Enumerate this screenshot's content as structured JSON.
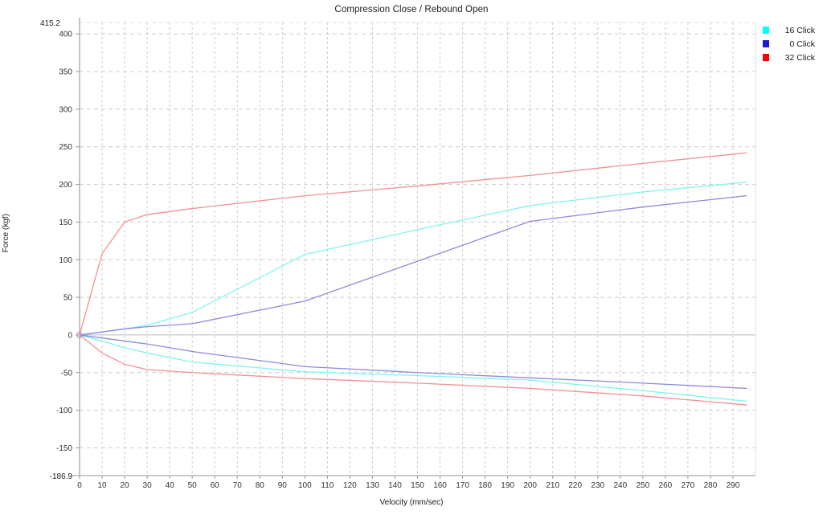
{
  "chart": {
    "title": "Compression Close / Rebound Open",
    "xlabel": "Velocity (mm/sec)",
    "ylabel": "Force (kgf)"
  },
  "legend": {
    "position": "top-right",
    "items": [
      {
        "label": "16 Click",
        "color": "#00ffff",
        "line_color": "#7ff5ef"
      },
      {
        "label": "0 Click",
        "color": "#1a1ad4",
        "line_color": "#8b8bdd"
      },
      {
        "label": "32 Click",
        "color": "#ff0000",
        "line_color": "#f59090"
      }
    ]
  },
  "axes": {
    "y_bound_top": "415.2",
    "y_bound_bottom": "-186.9",
    "y_ticks": [
      "400",
      "350",
      "300",
      "250",
      "200",
      "150",
      "100",
      "50",
      "0",
      "-50",
      "-100",
      "-150"
    ],
    "x_ticks": [
      "0",
      "10",
      "20",
      "30",
      "40",
      "50",
      "60",
      "70",
      "80",
      "90",
      "100",
      "110",
      "120",
      "130",
      "140",
      "150",
      "160",
      "170",
      "180",
      "190",
      "200",
      "210",
      "220",
      "230",
      "240",
      "250",
      "260",
      "270",
      "280",
      "290"
    ]
  },
  "chart_data": {
    "type": "line",
    "title": "Compression Close / Rebound Open",
    "xlabel": "Velocity (mm/sec)",
    "ylabel": "Force (kgf)",
    "xlim": [
      0,
      300
    ],
    "ylim": [
      -186.9,
      415.2
    ],
    "ytick_values": [
      400,
      350,
      300,
      250,
      200,
      150,
      100,
      50,
      0,
      -50,
      -100,
      -150
    ],
    "xtick_values": [
      0,
      10,
      20,
      30,
      40,
      50,
      60,
      70,
      80,
      90,
      100,
      110,
      120,
      130,
      140,
      150,
      160,
      170,
      180,
      190,
      200,
      210,
      220,
      230,
      240,
      250,
      260,
      270,
      280,
      290
    ],
    "grid": true,
    "legend_position": "top-right",
    "series": [
      {
        "name": "16 Click",
        "color": "#7ff5ef",
        "branch": "compression",
        "points": [
          [
            0,
            0
          ],
          [
            10,
            4
          ],
          [
            20,
            8
          ],
          [
            30,
            13
          ],
          [
            50,
            30
          ],
          [
            100,
            107
          ],
          [
            150,
            140
          ],
          [
            200,
            172
          ],
          [
            250,
            190
          ],
          [
            296,
            203
          ]
        ]
      },
      {
        "name": "16 Click",
        "color": "#7ff5ef",
        "branch": "rebound",
        "points": [
          [
            0,
            0
          ],
          [
            10,
            -8
          ],
          [
            20,
            -17
          ],
          [
            30,
            -24
          ],
          [
            50,
            -36
          ],
          [
            100,
            -49
          ],
          [
            150,
            -54
          ],
          [
            200,
            -60
          ],
          [
            250,
            -74
          ],
          [
            296,
            -88
          ]
        ]
      },
      {
        "name": "0 Click",
        "color": "#8b8bdd",
        "branch": "compression",
        "points": [
          [
            0,
            0
          ],
          [
            10,
            4
          ],
          [
            20,
            8
          ],
          [
            30,
            11
          ],
          [
            50,
            15
          ],
          [
            100,
            45
          ],
          [
            150,
            98
          ],
          [
            200,
            151
          ],
          [
            250,
            170
          ],
          [
            296,
            185
          ]
        ]
      },
      {
        "name": "0 Click",
        "color": "#8b8bdd",
        "branch": "rebound",
        "points": [
          [
            0,
            0
          ],
          [
            10,
            -4
          ],
          [
            20,
            -8
          ],
          [
            30,
            -12
          ],
          [
            50,
            -22
          ],
          [
            100,
            -42
          ],
          [
            150,
            -50
          ],
          [
            200,
            -57
          ],
          [
            250,
            -64
          ],
          [
            296,
            -71
          ]
        ]
      },
      {
        "name": "32 Click",
        "color": "#f59090",
        "branch": "compression",
        "points": [
          [
            0,
            0
          ],
          [
            10,
            108
          ],
          [
            20,
            150
          ],
          [
            30,
            160
          ],
          [
            50,
            168
          ],
          [
            100,
            185
          ],
          [
            150,
            198
          ],
          [
            200,
            212
          ],
          [
            250,
            228
          ],
          [
            296,
            242
          ]
        ]
      },
      {
        "name": "32 Click",
        "color": "#f59090",
        "branch": "rebound",
        "points": [
          [
            0,
            0
          ],
          [
            10,
            -24
          ],
          [
            20,
            -39
          ],
          [
            30,
            -46
          ],
          [
            50,
            -50
          ],
          [
            100,
            -58
          ],
          [
            150,
            -64
          ],
          [
            200,
            -71
          ],
          [
            250,
            -81
          ],
          [
            296,
            -93
          ]
        ]
      }
    ]
  }
}
